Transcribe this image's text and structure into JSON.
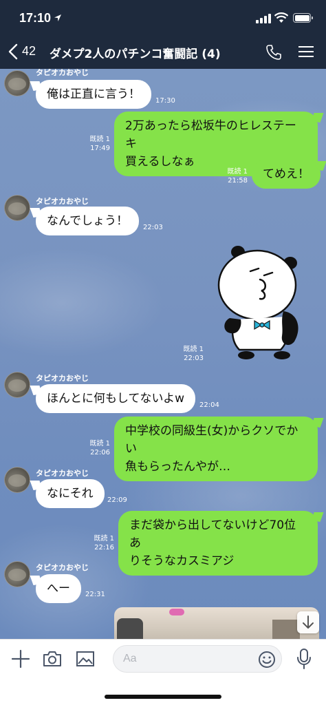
{
  "status_bar": {
    "time": "17:10"
  },
  "header": {
    "back_count": "42",
    "title": "ダメプ2人のパチンコ奮闘記 (4)"
  },
  "sender_name": "タピオカおやじ",
  "messages": [
    {
      "text": "俺は正直に言う！",
      "time": "17:30"
    },
    {
      "text_line1": "2万あったら松坂牛のヒレステーキ",
      "text_line2": "買えるしなぁ",
      "read": "既読 1",
      "time": "17:49"
    },
    {
      "text": "てめえ！",
      "read": "既読 1",
      "time": "21:58"
    },
    {
      "text": "なんでしょう！",
      "time": "22:03"
    },
    {
      "sticker": "panda-sticker",
      "read": "既読 1",
      "time": "22:03"
    },
    {
      "text": "ほんとに何もしてないよw",
      "time": "22:04"
    },
    {
      "text_line1": "中学校の同級生(女)からクソでかい",
      "text_line2": "魚もらったんやが…",
      "read": "既読 1",
      "time": "22:06"
    },
    {
      "text": "なにそれ",
      "time": "22:09"
    },
    {
      "text_line1": "まだ袋から出してないけど70位あ",
      "text_line2": "りそうなカスミアジ",
      "read": "既読 1",
      "time": "22:16"
    },
    {
      "text": "へー",
      "time": "22:31"
    }
  ],
  "input": {
    "placeholder": "Aa"
  },
  "colors": {
    "header_bg": "#1e2a3d",
    "out_bubble": "#85e249",
    "in_bubble": "#ffffff",
    "chat_bg": "#7893c0"
  }
}
